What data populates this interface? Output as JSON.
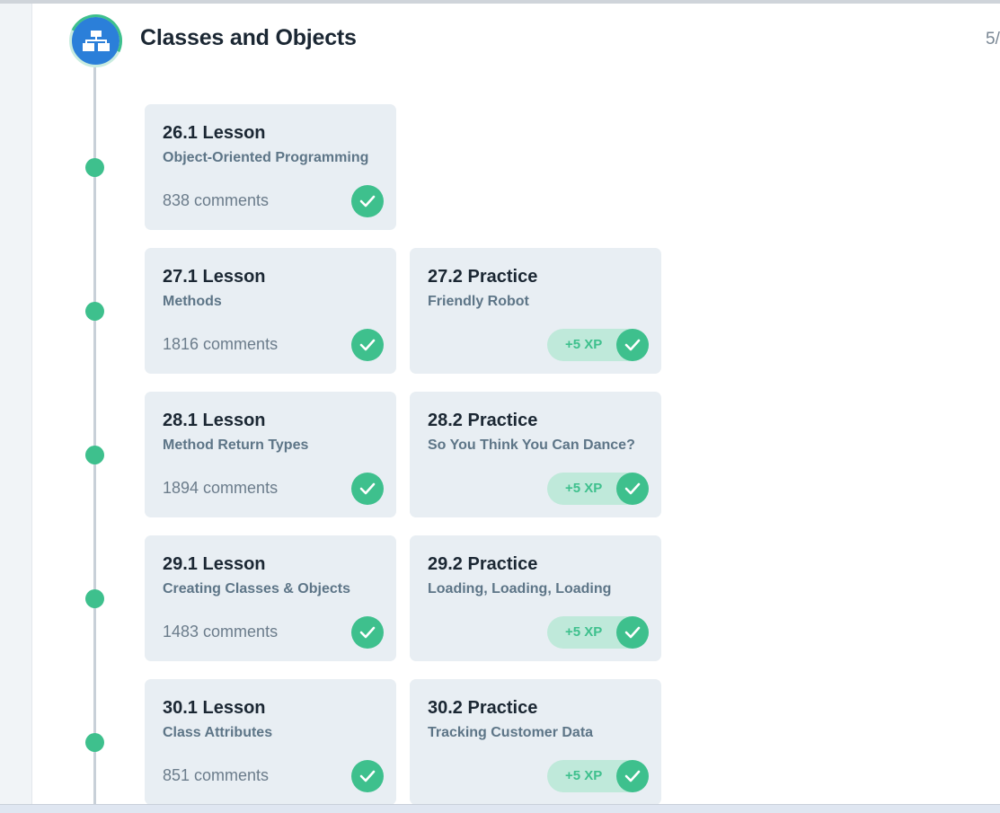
{
  "module": {
    "title": "Classes and Objects",
    "progress": "5/"
  },
  "rows": [
    {
      "lesson": {
        "title": "26.1 Lesson",
        "subtitle": "Object-Oriented Programming",
        "comments": "838 comments",
        "completed": true
      }
    },
    {
      "lesson": {
        "title": "27.1 Lesson",
        "subtitle": "Methods",
        "comments": "1816 comments",
        "completed": true
      },
      "practice": {
        "title": "27.2 Practice",
        "subtitle": "Friendly Robot",
        "xp": "+5 XP",
        "completed": true
      }
    },
    {
      "lesson": {
        "title": "28.1 Lesson",
        "subtitle": "Method Return Types",
        "comments": "1894 comments",
        "completed": true
      },
      "practice": {
        "title": "28.2 Practice",
        "subtitle": "So You Think You Can Dance?",
        "xp": "+5 XP",
        "completed": true
      }
    },
    {
      "lesson": {
        "title": "29.1 Lesson",
        "subtitle": "Creating Classes & Objects",
        "comments": "1483 comments",
        "completed": true
      },
      "practice": {
        "title": "29.2 Practice",
        "subtitle": "Loading, Loading, Loading",
        "xp": "+5 XP",
        "completed": true
      }
    },
    {
      "lesson": {
        "title": "30.1 Lesson",
        "subtitle": "Class Attributes",
        "comments": "851 comments",
        "completed": true
      },
      "practice": {
        "title": "30.2 Practice",
        "subtitle": "Tracking Customer Data",
        "xp": "+5 XP",
        "completed": true
      }
    }
  ],
  "colors": {
    "accent": "#3ec08d",
    "icon_bg": "#2b7fd9",
    "card_bg": "#e8eef3"
  },
  "icons": {
    "module": "class-diagram-icon",
    "status": "checkmark-icon"
  }
}
